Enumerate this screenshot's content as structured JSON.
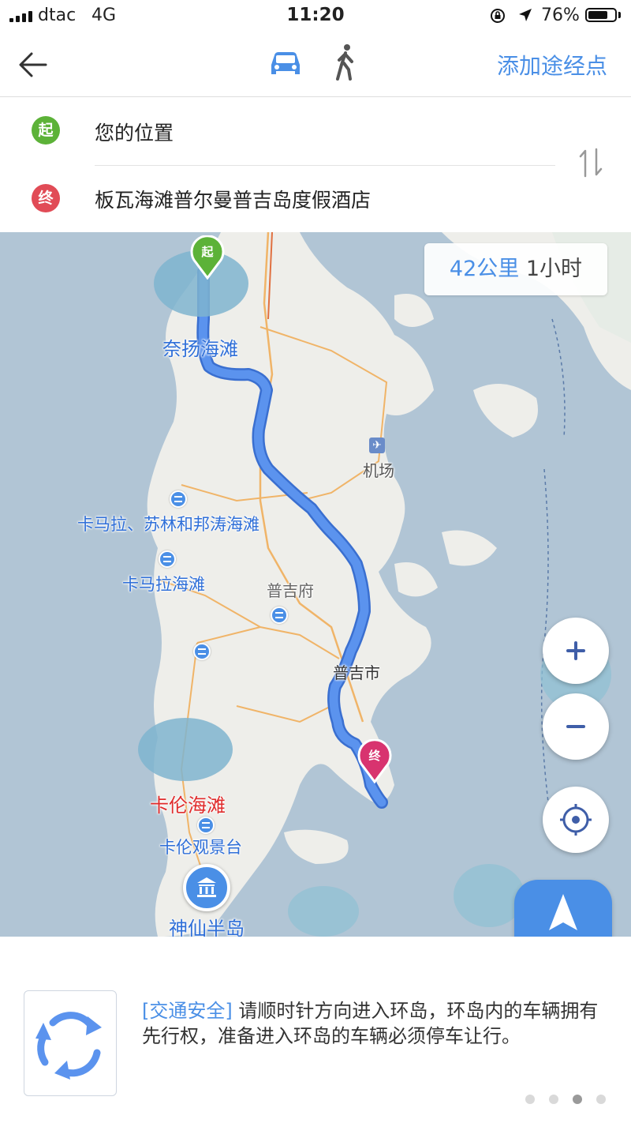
{
  "status_bar": {
    "carrier": "dtac",
    "network": "4G",
    "time": "11:20",
    "battery_percent": "76%",
    "battery_level": 0.76
  },
  "navbar": {
    "back_icon": "back-arrow-icon",
    "modes": [
      {
        "name": "car-icon",
        "active": true
      },
      {
        "name": "walk-icon",
        "active": false
      }
    ],
    "add_waypoint": "添加途经点"
  },
  "route": {
    "start_badge": "起",
    "start_value": "您的位置",
    "end_badge": "终",
    "end_value": "板瓦海滩普尔曼普吉岛度假酒店",
    "swap_icon": "swap-icon"
  },
  "map": {
    "summary": {
      "distance": "42公里",
      "duration": "1小时"
    },
    "labels": {
      "nai_yang": "奈扬海滩",
      "airport": "机场",
      "kamala_surin": "卡马拉、苏林和邦涛海滩",
      "kamala": "卡马拉海滩",
      "phuket_province": "普吉府",
      "phuket_town": "普吉市",
      "karon": "卡伦海滩",
      "karon_view": "卡伦观景台",
      "promthep": "神仙半岛"
    },
    "start_marker": "起",
    "end_marker": "终",
    "controls": {
      "zoom_in": "+",
      "zoom_out": "−",
      "navigate": "导航"
    },
    "colors": {
      "route": "#4a8fe6",
      "water": "#b1c5d5",
      "land": "#eeeeea",
      "road": "#f0b468"
    }
  },
  "tip": {
    "tag": "[交通安全]",
    "text": " 请顺时针方向进入环岛，环岛内的车辆拥有先行权，准备进入环岛的车辆必须停车让行。",
    "icon": "roundabout-icon",
    "pages": 4,
    "active_page": 3
  }
}
